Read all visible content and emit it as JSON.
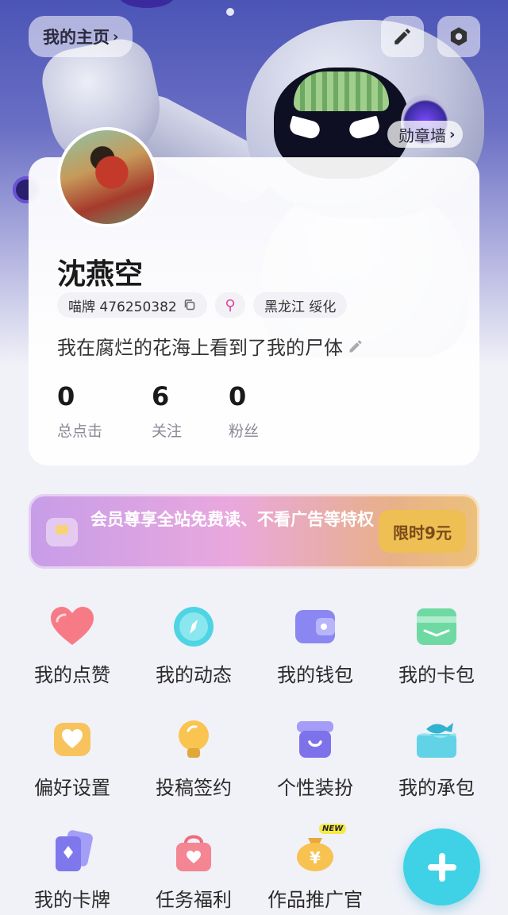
{
  "header": {
    "home_label": "我的主页",
    "medal_wall_label": "勋章墙"
  },
  "profile": {
    "username": "沈燕空",
    "id_label": "喵牌 476250382",
    "location": "黑龙江 绥化",
    "bio": "我在腐烂的花海上看到了我的尸体",
    "stats": [
      {
        "value": "0",
        "label": "总点击"
      },
      {
        "value": "6",
        "label": "关注"
      },
      {
        "value": "0",
        "label": "粉丝"
      }
    ]
  },
  "vip": {
    "text": "会员尊享全站免费读、不看广告等特权",
    "button": "限时9元"
  },
  "menu": [
    {
      "label": "我的点赞",
      "icon": "heart-icon"
    },
    {
      "label": "我的动态",
      "icon": "compass-icon"
    },
    {
      "label": "我的钱包",
      "icon": "wallet-icon"
    },
    {
      "label": "我的卡包",
      "icon": "card-pack-icon"
    },
    {
      "label": "偏好设置",
      "icon": "preference-icon"
    },
    {
      "label": "投稿签约",
      "icon": "lightbulb-icon"
    },
    {
      "label": "个性装扮",
      "icon": "shop-icon"
    },
    {
      "label": "我的承包",
      "icon": "fish-tank-icon"
    },
    {
      "label": "我的卡牌",
      "icon": "playing-card-icon"
    },
    {
      "label": "任务福利",
      "icon": "gift-bag-icon"
    },
    {
      "label": "作品推广官",
      "icon": "money-bag-icon",
      "badge": "NEW"
    }
  ],
  "colors": {
    "accent": "#3fd2e6",
    "vip_button": "#eebf52",
    "gender": "#e2429a"
  }
}
